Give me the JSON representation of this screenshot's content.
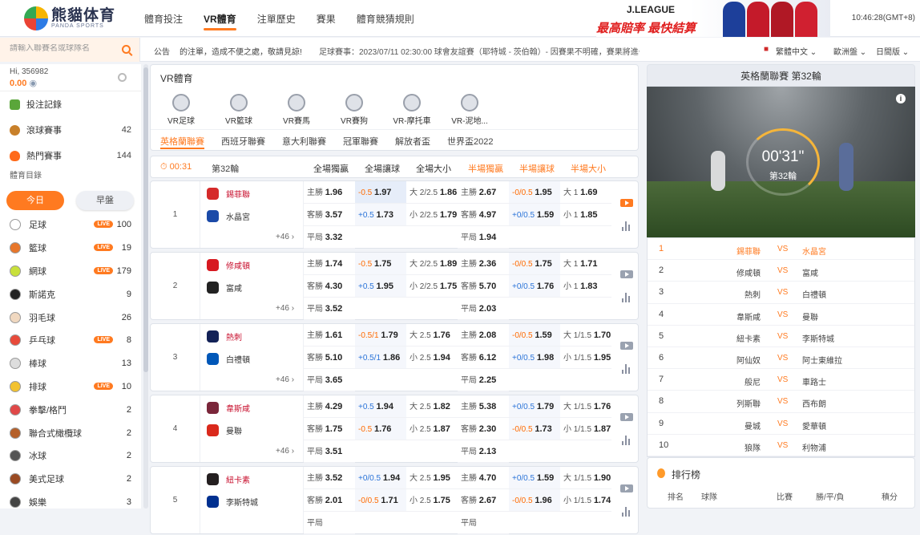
{
  "header": {
    "logo_main": "熊貓体育",
    "logo_sub": "PANDA SPORTS",
    "nav": [
      "體育投注",
      "VR體育",
      "注單歷史",
      "賽果",
      "體育競猜規則"
    ],
    "banner_brand": "J.LEAGUE",
    "banner_slogan": "最高賠率 最快結算",
    "clock": "10:46:28(GMT+8)"
  },
  "toolbar": {
    "search_placeholder": "請輸入聯賽名或球隊名",
    "notice_label": "公告",
    "notice_text": "的注單，造成不便之處，敬請見諒!",
    "ticker": "足球賽事：2023/07/11 02:30:00 球會友誼賽（耶特城 - 茨伯翰）- 因賽果不明確，賽果將進一步",
    "language": "繁體中文",
    "odds_format": "歐洲盤",
    "theme": "日間版"
  },
  "account": {
    "user": "Hi, 356982",
    "balance": "0.00"
  },
  "sidebar": {
    "quick": [
      {
        "label": "投注記錄",
        "count": ""
      },
      {
        "label": "滾球賽事",
        "count": "42"
      },
      {
        "label": "熱門賽事",
        "count": "144"
      }
    ],
    "directory": "體育目錄",
    "today": "今日",
    "early": "早盤",
    "live_tag": "LIVE",
    "sports": [
      {
        "label": "足球",
        "count": "100",
        "live": true,
        "color": "#ffffff"
      },
      {
        "label": "籃球",
        "count": "19",
        "live": true,
        "color": "#e7762b"
      },
      {
        "label": "網球",
        "count": "179",
        "live": true,
        "color": "#c8e03a"
      },
      {
        "label": "斯諾克",
        "count": "9",
        "live": false,
        "color": "#222222"
      },
      {
        "label": "羽毛球",
        "count": "26",
        "live": false,
        "color": "#f0d8c0"
      },
      {
        "label": "乒乓球",
        "count": "8",
        "live": true,
        "color": "#e84a3a"
      },
      {
        "label": "棒球",
        "count": "13",
        "live": false,
        "color": "#dddddd"
      },
      {
        "label": "排球",
        "count": "10",
        "live": true,
        "color": "#f2c230"
      },
      {
        "label": "拳擊/格鬥",
        "count": "2",
        "live": false,
        "color": "#e04848"
      },
      {
        "label": "聯合式橄欖球",
        "count": "2",
        "live": false,
        "color": "#b5602a"
      },
      {
        "label": "冰球",
        "count": "2",
        "live": false,
        "color": "#555555"
      },
      {
        "label": "美式足球",
        "count": "2",
        "live": false,
        "color": "#9a4a22"
      },
      {
        "label": "娛樂",
        "count": "3",
        "live": false,
        "color": "#444444"
      }
    ]
  },
  "vr": {
    "title": "VR體育",
    "sports": [
      "VR足球",
      "VR籃球",
      "VR賽馬",
      "VR賽狗",
      "VR-摩托車",
      "VR-泥地..."
    ],
    "leagues": [
      "英格蘭聯賽",
      "西班牙聯賽",
      "意大利聯賽",
      "冠軍聯賽",
      "解放者盃",
      "世界盃2022"
    ]
  },
  "columns": {
    "countdown": "00:31",
    "round": "第32輪",
    "headers": [
      "全場獨贏",
      "全場讓球",
      "全場大小",
      "半場獨贏",
      "半場讓球",
      "半場大小"
    ]
  },
  "matches": [
    {
      "no": "1",
      "home": "錫菲聯",
      "away": "水晶宮",
      "more": "+46",
      "home_color": "#d52a2a",
      "away_color": "#1b4aa8",
      "ft1x2": [
        [
          "主勝",
          "1.96"
        ],
        [
          "客勝",
          "3.57"
        ],
        [
          "平局",
          "3.32"
        ]
      ],
      "fthc": [
        [
          "-0.5",
          "1.97"
        ],
        [
          "+0.5",
          "1.73"
        ]
      ],
      "ftou": [
        [
          "大 2/2.5",
          "1.86"
        ],
        [
          "小 2/2.5",
          "1.79"
        ]
      ],
      "ht1x2": [
        [
          "主勝",
          "2.67"
        ],
        [
          "客勝",
          "4.97"
        ],
        [
          "平局",
          "1.94"
        ]
      ],
      "hthc": [
        [
          "-0/0.5",
          "1.95"
        ],
        [
          "+0/0.5",
          "1.59"
        ]
      ],
      "htou": [
        [
          "大 1",
          "1.69"
        ],
        [
          "小 1",
          "1.85"
        ]
      ]
    },
    {
      "no": "2",
      "home": "修咸頓",
      "away": "富咸",
      "more": "+46",
      "home_color": "#d71920",
      "away_color": "#222222",
      "ft1x2": [
        [
          "主勝",
          "1.74"
        ],
        [
          "客勝",
          "4.30"
        ],
        [
          "平局",
          "3.52"
        ]
      ],
      "fthc": [
        [
          "-0.5",
          "1.75"
        ],
        [
          "+0.5",
          "1.95"
        ]
      ],
      "ftou": [
        [
          "大 2/2.5",
          "1.89"
        ],
        [
          "小 2/2.5",
          "1.75"
        ]
      ],
      "ht1x2": [
        [
          "主勝",
          "2.36"
        ],
        [
          "客勝",
          "5.70"
        ],
        [
          "平局",
          "2.03"
        ]
      ],
      "hthc": [
        [
          "-0/0.5",
          "1.75"
        ],
        [
          "+0/0.5",
          "1.76"
        ]
      ],
      "htou": [
        [
          "大 1",
          "1.71"
        ],
        [
          "小 1",
          "1.83"
        ]
      ]
    },
    {
      "no": "3",
      "home": "熱刺",
      "away": "白禮頓",
      "more": "+46",
      "home_color": "#132257",
      "away_color": "#0057b8",
      "ft1x2": [
        [
          "主勝",
          "1.61"
        ],
        [
          "客勝",
          "5.10"
        ],
        [
          "平局",
          "3.65"
        ]
      ],
      "fthc": [
        [
          "-0.5/1",
          "1.79"
        ],
        [
          "+0.5/1",
          "1.86"
        ]
      ],
      "ftou": [
        [
          "大 2.5",
          "1.76"
        ],
        [
          "小 2.5",
          "1.94"
        ]
      ],
      "ht1x2": [
        [
          "主勝",
          "2.08"
        ],
        [
          "客勝",
          "6.12"
        ],
        [
          "平局",
          "2.25"
        ]
      ],
      "hthc": [
        [
          "-0/0.5",
          "1.59"
        ],
        [
          "+0/0.5",
          "1.98"
        ]
      ],
      "htou": [
        [
          "大 1/1.5",
          "1.70"
        ],
        [
          "小 1/1.5",
          "1.95"
        ]
      ]
    },
    {
      "no": "4",
      "home": "韋斯咸",
      "away": "曼聯",
      "more": "+46",
      "home_color": "#7a263a",
      "away_color": "#da291c",
      "ft1x2": [
        [
          "主勝",
          "4.29"
        ],
        [
          "客勝",
          "1.75"
        ],
        [
          "平局",
          "3.51"
        ]
      ],
      "fthc": [
        [
          "+0.5",
          "1.94"
        ],
        [
          "-0.5",
          "1.76"
        ]
      ],
      "ftou": [
        [
          "大 2.5",
          "1.82"
        ],
        [
          "小 2.5",
          "1.87"
        ]
      ],
      "ht1x2": [
        [
          "主勝",
          "5.38"
        ],
        [
          "客勝",
          "2.30"
        ],
        [
          "平局",
          "2.13"
        ]
      ],
      "hthc": [
        [
          "+0/0.5",
          "1.79"
        ],
        [
          "-0/0.5",
          "1.73"
        ]
      ],
      "htou": [
        [
          "大 1/1.5",
          "1.76"
        ],
        [
          "小 1/1.5",
          "1.87"
        ]
      ]
    },
    {
      "no": "5",
      "home": "紐卡素",
      "away": "李斯特城",
      "more": "",
      "home_color": "#241f20",
      "away_color": "#003090",
      "ft1x2": [
        [
          "主勝",
          "3.52"
        ],
        [
          "客勝",
          "2.01"
        ],
        [
          "平局",
          ""
        ]
      ],
      "fthc": [
        [
          "+0/0.5",
          "1.94"
        ],
        [
          "-0/0.5",
          "1.71"
        ]
      ],
      "ftou": [
        [
          "大 2.5",
          "1.95"
        ],
        [
          "小 2.5",
          "1.75"
        ]
      ],
      "ht1x2": [
        [
          "主勝",
          "4.70"
        ],
        [
          "客勝",
          "2.67"
        ],
        [
          "平局",
          ""
        ]
      ],
      "hthc": [
        [
          "+0/0.5",
          "1.59"
        ],
        [
          "-0/0.5",
          "1.96"
        ]
      ],
      "htou": [
        [
          "大 1/1.5",
          "1.90"
        ],
        [
          "小 1/1.5",
          "1.74"
        ]
      ]
    }
  ],
  "video": {
    "title": "英格蘭聯賽  第32輪",
    "countdown": "00'31\"",
    "round": "第32輪",
    "info": "i"
  },
  "fixtures": [
    {
      "no": "1",
      "home": "錫菲聯",
      "away": "水晶宮"
    },
    {
      "no": "2",
      "home": "修咸頓",
      "away": "富咸"
    },
    {
      "no": "3",
      "home": "熱刺",
      "away": "白禮頓"
    },
    {
      "no": "4",
      "home": "韋斯咸",
      "away": "曼聯"
    },
    {
      "no": "5",
      "home": "紐卡素",
      "away": "李斯特城"
    },
    {
      "no": "6",
      "home": "阿仙奴",
      "away": "阿士東維拉"
    },
    {
      "no": "7",
      "home": "般尼",
      "away": "車路士"
    },
    {
      "no": "8",
      "home": "列斯聯",
      "away": "西布朗"
    },
    {
      "no": "9",
      "home": "曼城",
      "away": "愛華頓"
    },
    {
      "no": "10",
      "home": "狼隊",
      "away": "利物浦"
    }
  ],
  "vs": "VS",
  "ranking": {
    "title": "排行榜",
    "headers": [
      "排名",
      "球隊",
      "比賽",
      "勝/平/負",
      "積分"
    ]
  }
}
